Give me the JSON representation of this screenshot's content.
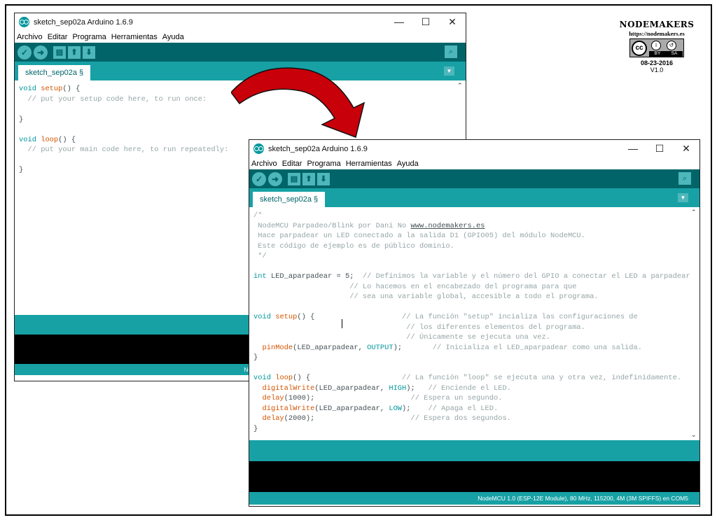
{
  "window1": {
    "title": "sketch_sep02a Arduino 1.6.9",
    "menu": [
      "Archivo",
      "Editar",
      "Programa",
      "Herramientas",
      "Ayuda"
    ],
    "tab": "sketch_sep02a §",
    "status": "NodeMCU 1.0 (ESP-12E Module), 80 MHz, 115200, 4M (3M SPIFFS) en COM5"
  },
  "window2": {
    "title": "sketch_sep02a Arduino 1.6.9",
    "menu": [
      "Archivo",
      "Editar",
      "Programa",
      "Herramientas",
      "Ayuda"
    ],
    "tab": "sketch_sep02a §",
    "status": "NodeMCU 1.0 (ESP-12E Module), 80 MHz, 115200, 4M (3M SPIFFS) en COM5"
  },
  "window_controls": {
    "minimize": "—",
    "maximize": "☐",
    "close": "✕"
  },
  "toolbar_icons": [
    "verify-icon",
    "upload-icon",
    "new-icon",
    "open-icon",
    "save-icon",
    "serial-monitor-icon"
  ],
  "code1": [
    [
      [
        "kw",
        "void"
      ],
      [
        "t",
        " "
      ],
      [
        "fn",
        "setup"
      ],
      [
        "t",
        "() {"
      ]
    ],
    [
      [
        "t",
        "  "
      ],
      [
        "cm",
        "// put your setup code here, to run once:"
      ]
    ],
    [
      [
        "t",
        ""
      ]
    ],
    [
      [
        "t",
        "}"
      ]
    ],
    [
      [
        "t",
        ""
      ]
    ],
    [
      [
        "kw",
        "void"
      ],
      [
        "t",
        " "
      ],
      [
        "fn",
        "loop"
      ],
      [
        "t",
        "() {"
      ]
    ],
    [
      [
        "t",
        "  "
      ],
      [
        "cm",
        "// put your main code here, to run repeatedly:"
      ]
    ],
    [
      [
        "t",
        ""
      ]
    ],
    [
      [
        "t",
        "}"
      ]
    ]
  ],
  "code2": [
    [
      [
        "cm",
        "/*"
      ]
    ],
    [
      [
        "cm",
        " NodeMCU Parpadeo/Blink por Dani No "
      ],
      [
        "lnk",
        "www.nodemakers.es"
      ]
    ],
    [
      [
        "cm",
        " Hace parpadear un LED conectado a la salida D1 (GPIO05) del módulo NodeMCU."
      ]
    ],
    [
      [
        "cm",
        " Este código de ejemplo es de público dominio."
      ]
    ],
    [
      [
        "cm",
        " */"
      ]
    ],
    [
      [
        "t",
        ""
      ]
    ],
    [
      [
        "kw",
        "int"
      ],
      [
        "t",
        " LED_aparpadear = 5;  "
      ],
      [
        "cm",
        "// Definimos la variable y el número del GPIO a conectar el LED a parpadear."
      ]
    ],
    [
      [
        "t",
        "                      "
      ],
      [
        "cm",
        "// Lo hacemos en el encabezado del programa para que"
      ]
    ],
    [
      [
        "t",
        "                      "
      ],
      [
        "cm",
        "// sea una variable global, accesible a todo el programa."
      ]
    ],
    [
      [
        "t",
        ""
      ]
    ],
    [
      [
        "kw",
        "void"
      ],
      [
        "t",
        " "
      ],
      [
        "fn",
        "setup"
      ],
      [
        "t",
        "() {                    "
      ],
      [
        "cm",
        "// La función \"setup\" incializa las configuraciones de"
      ]
    ],
    [
      [
        "t",
        "                                   "
      ],
      [
        "cm",
        "// los diferentes elementos del programa."
      ]
    ],
    [
      [
        "t",
        "                                   "
      ],
      [
        "cm",
        "// Únicamente se ejecuta una vez."
      ]
    ],
    [
      [
        "t",
        "  "
      ],
      [
        "fn",
        "pinMode"
      ],
      [
        "t",
        "(LED_aparpadear, "
      ],
      [
        "kw",
        "OUTPUT"
      ],
      [
        "t",
        ");       "
      ],
      [
        "cm",
        "// Inicializa el LED_aparpadear como una salida."
      ]
    ],
    [
      [
        "t",
        "}"
      ]
    ],
    [
      [
        "t",
        ""
      ]
    ],
    [
      [
        "kw",
        "void"
      ],
      [
        "t",
        " "
      ],
      [
        "fn",
        "loop"
      ],
      [
        "t",
        "() {                     "
      ],
      [
        "cm",
        "// La función \"loop\" se ejecuta una y otra vez, indefinidamente."
      ]
    ],
    [
      [
        "t",
        "  "
      ],
      [
        "fn",
        "digitalWrite"
      ],
      [
        "t",
        "(LED_aparpadear, "
      ],
      [
        "kw",
        "HIGH"
      ],
      [
        "t",
        ");   "
      ],
      [
        "cm",
        "// Enciende el LED."
      ]
    ],
    [
      [
        "t",
        "  "
      ],
      [
        "fn",
        "delay"
      ],
      [
        "t",
        "(1000);                      "
      ],
      [
        "cm",
        "// Espera un segundo."
      ]
    ],
    [
      [
        "t",
        "  "
      ],
      [
        "fn",
        "digitalWrite"
      ],
      [
        "t",
        "(LED_aparpadear, "
      ],
      [
        "kw",
        "LOW"
      ],
      [
        "t",
        ");    "
      ],
      [
        "cm",
        "// Apaga el LED."
      ]
    ],
    [
      [
        "t",
        "  "
      ],
      [
        "fn",
        "delay"
      ],
      [
        "t",
        "(2000);                      "
      ],
      [
        "cm",
        "// Espera dos segundos."
      ]
    ],
    [
      [
        "t",
        "}"
      ]
    ]
  ],
  "logo": {
    "name": "NODEMAKERS",
    "url": "https://nodemakers.es",
    "cc": "cc",
    "by": "BY",
    "sa": "SA",
    "date": "08-23-2016",
    "version": "V1.0"
  },
  "colors": {
    "toolbar": "#006468",
    "tabbar": "#17a1a5",
    "keyword": "#00979c",
    "function": "#d35400",
    "comment": "#95a5a6",
    "arrow": "#c8000a"
  }
}
